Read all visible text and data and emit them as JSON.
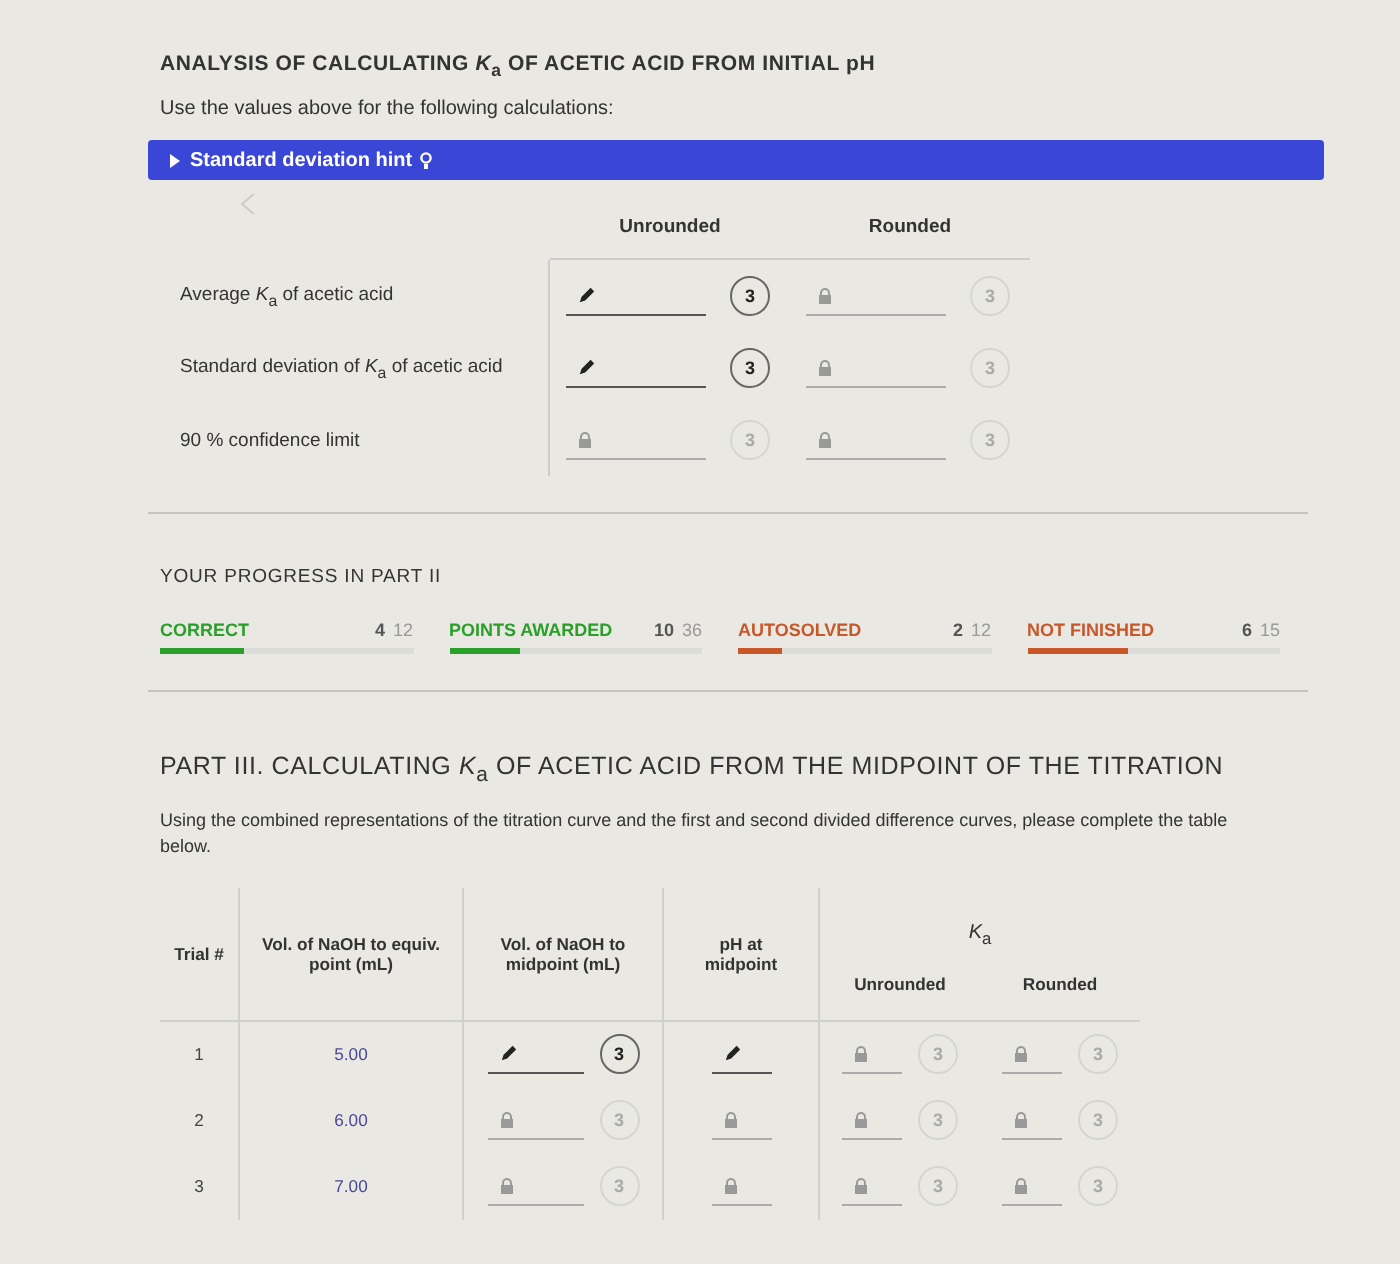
{
  "title": "ANALYSIS OF CALCULATING *K*$_{a}$ OF ACETIC ACID FROM INITIAL pH",
  "instruction": "Use the values above for the following calculations:",
  "hint": {
    "label": "Standard deviation hint",
    "expanded": false
  },
  "part2_table": {
    "columns": [
      "Unrounded",
      "Rounded"
    ],
    "rows": [
      {
        "label": "Average *K*$_{a}$ of acetic acid",
        "cells": [
          {
            "locked": false,
            "attempts": "3"
          },
          {
            "locked": true,
            "attempts": "3"
          }
        ]
      },
      {
        "label": "Standard deviation of *K*$_{a}$ of acetic acid",
        "cells": [
          {
            "locked": false,
            "attempts": "3"
          },
          {
            "locked": true,
            "attempts": "3"
          }
        ]
      },
      {
        "label": "90 % confidence limit",
        "cells": [
          {
            "locked": true,
            "attempts": "3"
          },
          {
            "locked": true,
            "attempts": "3"
          }
        ]
      }
    ]
  },
  "progress": {
    "title": "YOUR PROGRESS IN PART II",
    "items": [
      {
        "label": "CORRECT",
        "count": "4",
        "total": "12",
        "level": 0.33,
        "color": "#2aa02a"
      },
      {
        "label": "POINTS AWARDED",
        "count": "10",
        "total": "36",
        "level": 0.28,
        "color": "#2aa02a"
      },
      {
        "label": "AUTOSOLVED",
        "count": "2",
        "total": "12",
        "level": 0.17,
        "color": "#c8572a"
      },
      {
        "label": "NOT FINISHED",
        "count": "6",
        "total": "15",
        "level": 0.4,
        "color": "#c8572a"
      }
    ]
  },
  "part3": {
    "heading": "PART III. CALCULATING *K*$_{a}$ OF ACETIC ACID FROM THE MIDPOINT OF THE TITRATION",
    "text": "Using the combined representations of the titration curve and the first and second divided difference curves, please complete the table below.",
    "columns": [
      "Trial #",
      "Vol. of NaOH to equiv. point (mL)",
      "Vol. of NaOH to midpoint (mL)",
      "pH at midpoint"
    ],
    "group_header": "*K*$_{a}$",
    "subcolumns": [
      "Unrounded",
      "Rounded"
    ],
    "rows": [
      {
        "trial": "1",
        "equiv": "5.00",
        "midpoint": {
          "locked": false,
          "attempts": "3"
        },
        "ph": {
          "locked": false
        },
        "ka": [
          {
            "locked": true,
            "attempts": "3"
          },
          {
            "locked": true,
            "attempts": "3"
          }
        ]
      },
      {
        "trial": "2",
        "equiv": "6.00",
        "midpoint": {
          "locked": true,
          "attempts": "3"
        },
        "ph": {
          "locked": true
        },
        "ka": [
          {
            "locked": true,
            "attempts": "3"
          },
          {
            "locked": true,
            "attempts": "3"
          }
        ]
      },
      {
        "trial": "3",
        "equiv": "7.00",
        "midpoint": {
          "locked": true,
          "attempts": "3"
        },
        "ph": {
          "locked": true
        },
        "ka": [
          {
            "locked": true,
            "attempts": "3"
          },
          {
            "locked": true,
            "attempts": "3"
          }
        ]
      }
    ]
  }
}
